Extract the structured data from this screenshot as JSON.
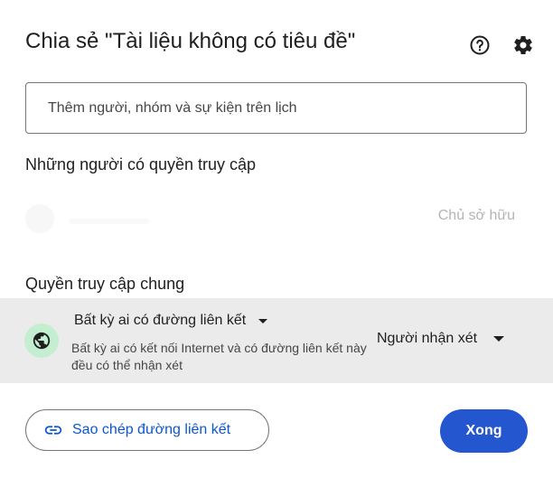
{
  "dialog": {
    "title": "Chia sẻ \"Tài liệu không có tiêu đề\"",
    "help_icon": "help-circle-icon",
    "settings_icon": "gear-icon"
  },
  "add_people": {
    "placeholder": "Thêm người, nhóm và sự kiện trên lịch",
    "value": ""
  },
  "people_with_access": {
    "title": "Những người có quyền truy cập",
    "owner_role": "Chủ sở hữu"
  },
  "general_access": {
    "title": "Quyền truy cập chung",
    "icon": "globe-icon",
    "selected_option": "Bất kỳ ai có đường liên kết",
    "description": "Bất kỳ ai có kết nối Internet và có đường liên kết này đều có thể nhận xét",
    "role": "Người nhận xét"
  },
  "footer": {
    "copy_link_label": "Sao chép đường liên kết",
    "copy_link_icon": "link-icon",
    "done_label": "Xong"
  },
  "colors": {
    "accent": "#0b57d0",
    "done_button": "#2456d0",
    "globe_bg": "#c4eed0",
    "general_row_bg": "#ebebeb"
  }
}
